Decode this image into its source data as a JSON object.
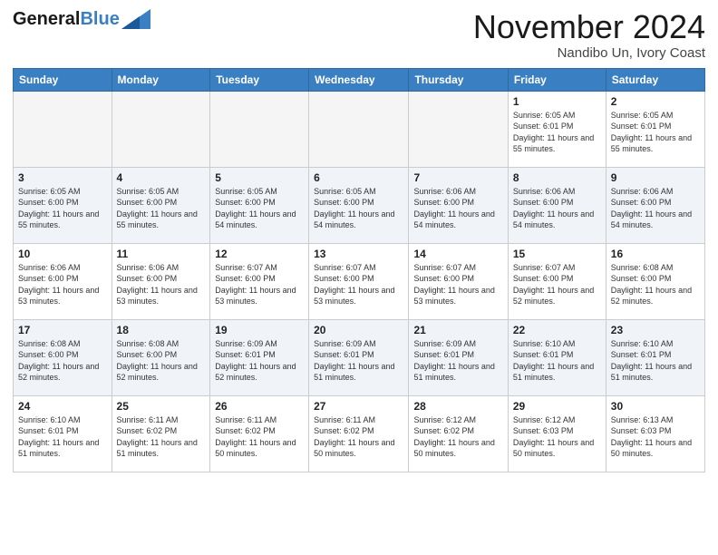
{
  "header": {
    "logo_general": "General",
    "logo_blue": "Blue",
    "month_title": "November 2024",
    "location": "Nandibo Un, Ivory Coast"
  },
  "days_of_week": [
    "Sunday",
    "Monday",
    "Tuesday",
    "Wednesday",
    "Thursday",
    "Friday",
    "Saturday"
  ],
  "weeks": [
    [
      {
        "day": "",
        "info": ""
      },
      {
        "day": "",
        "info": ""
      },
      {
        "day": "",
        "info": ""
      },
      {
        "day": "",
        "info": ""
      },
      {
        "day": "",
        "info": ""
      },
      {
        "day": "1",
        "info": "Sunrise: 6:05 AM\nSunset: 6:01 PM\nDaylight: 11 hours and 55 minutes."
      },
      {
        "day": "2",
        "info": "Sunrise: 6:05 AM\nSunset: 6:01 PM\nDaylight: 11 hours and 55 minutes."
      }
    ],
    [
      {
        "day": "3",
        "info": "Sunrise: 6:05 AM\nSunset: 6:00 PM\nDaylight: 11 hours and 55 minutes."
      },
      {
        "day": "4",
        "info": "Sunrise: 6:05 AM\nSunset: 6:00 PM\nDaylight: 11 hours and 55 minutes."
      },
      {
        "day": "5",
        "info": "Sunrise: 6:05 AM\nSunset: 6:00 PM\nDaylight: 11 hours and 54 minutes."
      },
      {
        "day": "6",
        "info": "Sunrise: 6:05 AM\nSunset: 6:00 PM\nDaylight: 11 hours and 54 minutes."
      },
      {
        "day": "7",
        "info": "Sunrise: 6:06 AM\nSunset: 6:00 PM\nDaylight: 11 hours and 54 minutes."
      },
      {
        "day": "8",
        "info": "Sunrise: 6:06 AM\nSunset: 6:00 PM\nDaylight: 11 hours and 54 minutes."
      },
      {
        "day": "9",
        "info": "Sunrise: 6:06 AM\nSunset: 6:00 PM\nDaylight: 11 hours and 54 minutes."
      }
    ],
    [
      {
        "day": "10",
        "info": "Sunrise: 6:06 AM\nSunset: 6:00 PM\nDaylight: 11 hours and 53 minutes."
      },
      {
        "day": "11",
        "info": "Sunrise: 6:06 AM\nSunset: 6:00 PM\nDaylight: 11 hours and 53 minutes."
      },
      {
        "day": "12",
        "info": "Sunrise: 6:07 AM\nSunset: 6:00 PM\nDaylight: 11 hours and 53 minutes."
      },
      {
        "day": "13",
        "info": "Sunrise: 6:07 AM\nSunset: 6:00 PM\nDaylight: 11 hours and 53 minutes."
      },
      {
        "day": "14",
        "info": "Sunrise: 6:07 AM\nSunset: 6:00 PM\nDaylight: 11 hours and 53 minutes."
      },
      {
        "day": "15",
        "info": "Sunrise: 6:07 AM\nSunset: 6:00 PM\nDaylight: 11 hours and 52 minutes."
      },
      {
        "day": "16",
        "info": "Sunrise: 6:08 AM\nSunset: 6:00 PM\nDaylight: 11 hours and 52 minutes."
      }
    ],
    [
      {
        "day": "17",
        "info": "Sunrise: 6:08 AM\nSunset: 6:00 PM\nDaylight: 11 hours and 52 minutes."
      },
      {
        "day": "18",
        "info": "Sunrise: 6:08 AM\nSunset: 6:00 PM\nDaylight: 11 hours and 52 minutes."
      },
      {
        "day": "19",
        "info": "Sunrise: 6:09 AM\nSunset: 6:01 PM\nDaylight: 11 hours and 52 minutes."
      },
      {
        "day": "20",
        "info": "Sunrise: 6:09 AM\nSunset: 6:01 PM\nDaylight: 11 hours and 51 minutes."
      },
      {
        "day": "21",
        "info": "Sunrise: 6:09 AM\nSunset: 6:01 PM\nDaylight: 11 hours and 51 minutes."
      },
      {
        "day": "22",
        "info": "Sunrise: 6:10 AM\nSunset: 6:01 PM\nDaylight: 11 hours and 51 minutes."
      },
      {
        "day": "23",
        "info": "Sunrise: 6:10 AM\nSunset: 6:01 PM\nDaylight: 11 hours and 51 minutes."
      }
    ],
    [
      {
        "day": "24",
        "info": "Sunrise: 6:10 AM\nSunset: 6:01 PM\nDaylight: 11 hours and 51 minutes."
      },
      {
        "day": "25",
        "info": "Sunrise: 6:11 AM\nSunset: 6:02 PM\nDaylight: 11 hours and 51 minutes."
      },
      {
        "day": "26",
        "info": "Sunrise: 6:11 AM\nSunset: 6:02 PM\nDaylight: 11 hours and 50 minutes."
      },
      {
        "day": "27",
        "info": "Sunrise: 6:11 AM\nSunset: 6:02 PM\nDaylight: 11 hours and 50 minutes."
      },
      {
        "day": "28",
        "info": "Sunrise: 6:12 AM\nSunset: 6:02 PM\nDaylight: 11 hours and 50 minutes."
      },
      {
        "day": "29",
        "info": "Sunrise: 6:12 AM\nSunset: 6:03 PM\nDaylight: 11 hours and 50 minutes."
      },
      {
        "day": "30",
        "info": "Sunrise: 6:13 AM\nSunset: 6:03 PM\nDaylight: 11 hours and 50 minutes."
      }
    ]
  ]
}
